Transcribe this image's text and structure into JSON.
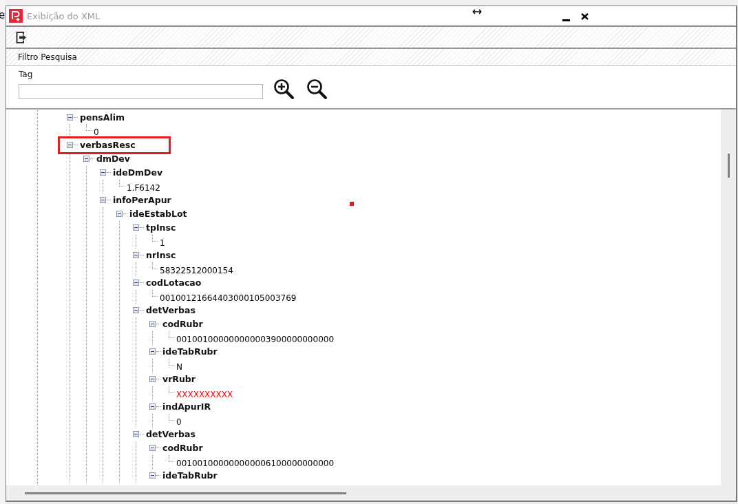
{
  "backdrop_text": "e",
  "window": {
    "title": "Exibição do XML"
  },
  "filter": {
    "section_title": "Filtro Pesquisa",
    "tag_label": "Tag"
  },
  "tree": [
    {
      "kind": "element",
      "tag": "pensAlim",
      "expanded": true,
      "highlighted": false,
      "children": [
        {
          "kind": "value",
          "text": "0",
          "color": "#000000"
        }
      ]
    },
    {
      "kind": "element",
      "tag": "verbasResc",
      "expanded": true,
      "highlighted": true,
      "children": [
        {
          "kind": "element",
          "tag": "dmDev",
          "expanded": true,
          "highlighted": false,
          "children": [
            {
              "kind": "element",
              "tag": "ideDmDev",
              "expanded": true,
              "highlighted": false,
              "children": [
                {
                  "kind": "value",
                  "text": "1.F6142",
                  "color": "#000000"
                }
              ]
            },
            {
              "kind": "element",
              "tag": "infoPerApur",
              "expanded": true,
              "highlighted": false,
              "children": [
                {
                  "kind": "element",
                  "tag": "ideEstabLot",
                  "expanded": true,
                  "highlighted": false,
                  "children": [
                    {
                      "kind": "element",
                      "tag": "tpInsc",
                      "expanded": true,
                      "highlighted": false,
                      "children": [
                        {
                          "kind": "value",
                          "text": "1",
                          "color": "#000000"
                        }
                      ]
                    },
                    {
                      "kind": "element",
                      "tag": "nrInsc",
                      "expanded": true,
                      "highlighted": false,
                      "children": [
                        {
                          "kind": "value",
                          "text": "58322512000154",
                          "color": "#000000"
                        }
                      ]
                    },
                    {
                      "kind": "element",
                      "tag": "codLotacao",
                      "expanded": true,
                      "highlighted": false,
                      "children": [
                        {
                          "kind": "value",
                          "text": "00100121664403000105003769",
                          "color": "#000000"
                        }
                      ]
                    },
                    {
                      "kind": "element",
                      "tag": "detVerbas",
                      "expanded": true,
                      "highlighted": false,
                      "children": [
                        {
                          "kind": "element",
                          "tag": "codRubr",
                          "expanded": true,
                          "highlighted": false,
                          "children": [
                            {
                              "kind": "value",
                              "text": "001001000000000003900000000000",
                              "color": "#000000"
                            }
                          ]
                        },
                        {
                          "kind": "element",
                          "tag": "ideTabRubr",
                          "expanded": true,
                          "highlighted": false,
                          "children": [
                            {
                              "kind": "value",
                              "text": "N",
                              "color": "#000000"
                            }
                          ]
                        },
                        {
                          "kind": "element",
                          "tag": "vrRubr",
                          "expanded": true,
                          "highlighted": false,
                          "children": [
                            {
                              "kind": "value",
                              "text": "XXXXXXXXXX",
                              "color": "#ff0000"
                            }
                          ]
                        },
                        {
                          "kind": "element",
                          "tag": "indApurIR",
                          "expanded": true,
                          "highlighted": false,
                          "children": [
                            {
                              "kind": "value",
                              "text": "0",
                              "color": "#000000"
                            }
                          ]
                        }
                      ]
                    },
                    {
                      "kind": "element",
                      "tag": "detVerbas",
                      "expanded": true,
                      "highlighted": false,
                      "children": [
                        {
                          "kind": "element",
                          "tag": "codRubr",
                          "expanded": true,
                          "highlighted": false,
                          "children": [
                            {
                              "kind": "value",
                              "text": "001001000000000006100000000000",
                              "color": "#000000"
                            }
                          ]
                        },
                        {
                          "kind": "element",
                          "tag": "ideTabRubr",
                          "expanded": true,
                          "highlighted": false
                        }
                      ]
                    }
                  ]
                }
              ]
            }
          ]
        }
      ]
    }
  ]
}
